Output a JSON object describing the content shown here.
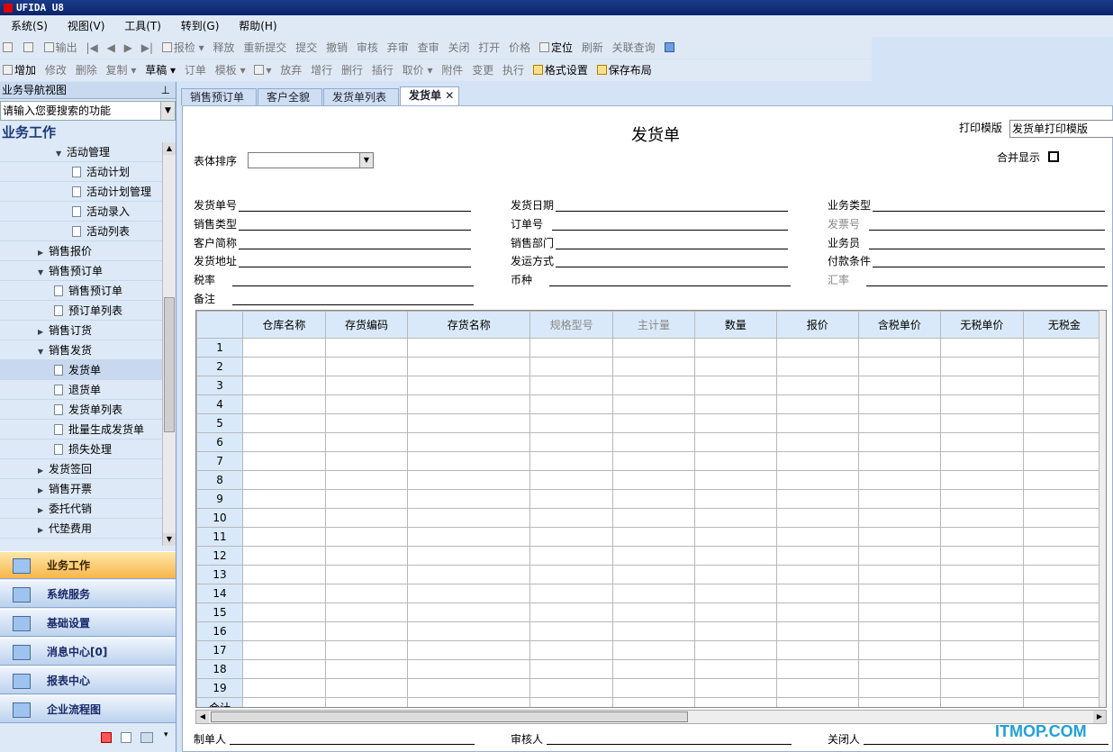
{
  "app_title": "UFIDA U8",
  "menu": [
    "系统(S)",
    "视图(V)",
    "工具(T)",
    "转到(G)",
    "帮助(H)"
  ],
  "toolbar1": [
    "打印",
    "预览",
    "输出",
    "首张",
    "上张",
    "下张",
    "末张",
    "报检",
    "释放",
    "重新提交",
    "提交",
    "撤销",
    "审核",
    "弃审",
    "查审",
    "关闭",
    "打开",
    "价格",
    "定位",
    "刷新",
    "关联查询"
  ],
  "toolbar2": [
    "增加",
    "修改",
    "删除",
    "复制",
    "草稿",
    "订单",
    "模板",
    "保存",
    "放弃",
    "增行",
    "删行",
    "插行",
    "取价",
    "附件",
    "变更",
    "执行",
    "格式设置",
    "保存布局"
  ],
  "nav": {
    "header": "业务导航视图",
    "search_placeholder": "请输入您要搜索的功能",
    "title": "业务工作",
    "tree": [
      "活动管理",
      "活动计划",
      "活动计划管理",
      "活动录入",
      "活动列表",
      "销售报价",
      "销售预订单",
      "销售预订单",
      "预订单列表",
      "销售订货",
      "销售发货",
      "发货单",
      "退货单",
      "发货单列表",
      "批量生成发货单",
      "损失处理",
      "发货签回",
      "销售开票",
      "委托代销",
      "代垫费用"
    ],
    "big_buttons": [
      "业务工作",
      "系统服务",
      "基础设置",
      "消息中心[0]",
      "报表中心",
      "企业流程图"
    ]
  },
  "tabs": [
    "销售预订单",
    "客户全貌",
    "发货单列表",
    "发货单"
  ],
  "doc": {
    "title": "发货单",
    "print_template_label": "打印模版",
    "print_template_value": "发货单打印模版",
    "merge_label": "合并显示",
    "sort_label": "表体排序",
    "fields": [
      "发货单号",
      "发货日期",
      "业务类型",
      "销售类型",
      "订单号",
      "发票号",
      "客户简称",
      "销售部门",
      "业务员",
      "发货地址",
      "发运方式",
      "付款条件",
      "税率",
      "币种",
      "汇率",
      "备注"
    ],
    "columns": [
      "仓库名称",
      "存货编码",
      "存货名称",
      "规格型号",
      "主计量",
      "数量",
      "报价",
      "含税单价",
      "无税单价",
      "无税金"
    ],
    "rows": [
      "1",
      "2",
      "3",
      "4",
      "5",
      "6",
      "7",
      "8",
      "9",
      "10",
      "11",
      "12",
      "13",
      "14",
      "15",
      "16",
      "17",
      "18",
      "19"
    ],
    "total_label": "合计",
    "footer": [
      "制单人",
      "审核人",
      "关闭人"
    ]
  },
  "watermark": "ITMOP.COM"
}
